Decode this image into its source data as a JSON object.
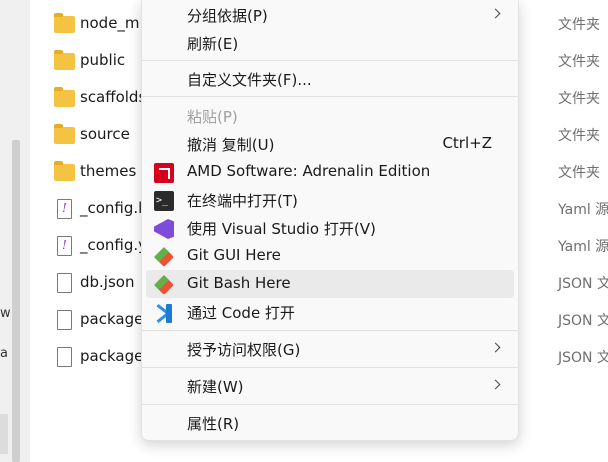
{
  "left_fragments": [
    "w",
    "a"
  ],
  "files": [
    {
      "name": "node_m",
      "type": "文件夹",
      "kind": "folder"
    },
    {
      "name": "public",
      "type": "文件夹",
      "kind": "folder"
    },
    {
      "name": "scaffolds",
      "type": "文件夹",
      "kind": "folder"
    },
    {
      "name": "source",
      "type": "文件夹",
      "kind": "folder"
    },
    {
      "name": "themes",
      "type": "文件夹",
      "kind": "folder"
    },
    {
      "name": "_config.l",
      "type": "Yaml 源",
      "kind": "yaml"
    },
    {
      "name": "_config.y",
      "type": "Yaml 源",
      "kind": "yaml"
    },
    {
      "name": "db.json",
      "type": "JSON 文",
      "kind": "doc"
    },
    {
      "name": "package",
      "type": "JSON 文",
      "kind": "doc"
    },
    {
      "name": "package",
      "type": "JSON 文",
      "kind": "doc"
    }
  ],
  "menu": {
    "group_by": "分组依据(P)",
    "refresh": "刷新(E)",
    "customize_folder": "自定义文件夹(F)...",
    "paste": "粘贴(P)",
    "undo_copy": "撤消 复制(U)",
    "undo_shortcut": "Ctrl+Z",
    "amd_software": "AMD Software: Adrenalin Edition",
    "open_in_terminal": "在终端中打开(T)",
    "open_with_vs": "使用 Visual Studio 打开(V)",
    "git_gui": "Git GUI Here",
    "git_bash": "Git Bash Here",
    "open_with_code": "通过 Code 打开",
    "grant_access": "授予访问权限(G)",
    "new": "新建(W)",
    "properties": "属性(R)"
  },
  "colors": {
    "folder": "#f5c342",
    "amd": "#d6001c",
    "visual_studio": "#7d4cdb",
    "vscode": "#1f7ad1",
    "git": "#f05033",
    "menu_hover": "#eaeaea"
  }
}
